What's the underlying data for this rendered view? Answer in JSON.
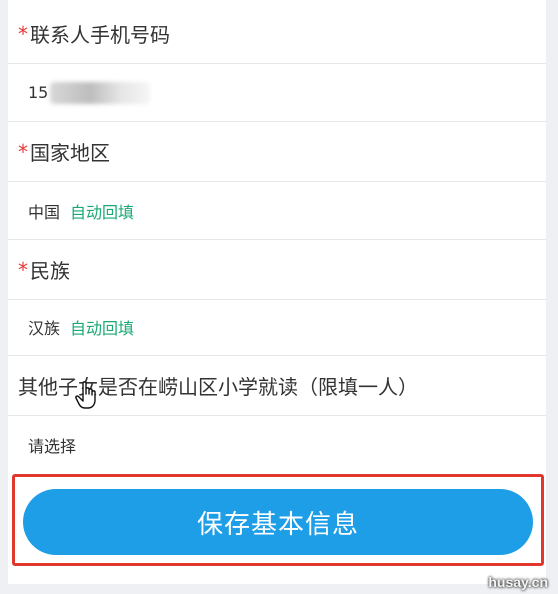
{
  "form": {
    "contact_phone": {
      "required_mark": "*",
      "label": "联系人手机号码",
      "value_prefix": "15"
    },
    "country": {
      "required_mark": "*",
      "label": "国家地区",
      "value": "中国",
      "auto_tag": "自动回填"
    },
    "ethnicity": {
      "required_mark": "*",
      "label": "民族",
      "value": "汉族",
      "auto_tag": "自动回填"
    },
    "sibling_school": {
      "label": "其他子女是否在崂山区小学就读（限填一人）",
      "placeholder": "请选择"
    }
  },
  "actions": {
    "save_label": "保存基本信息"
  },
  "watermark": "husay.cn",
  "colors": {
    "required": "#e53935",
    "auto_tag": "#19a974",
    "primary_button": "#1f9ee8",
    "highlight_border": "#e2372c"
  },
  "icons": {
    "cursor": "hand-pointer-icon"
  }
}
